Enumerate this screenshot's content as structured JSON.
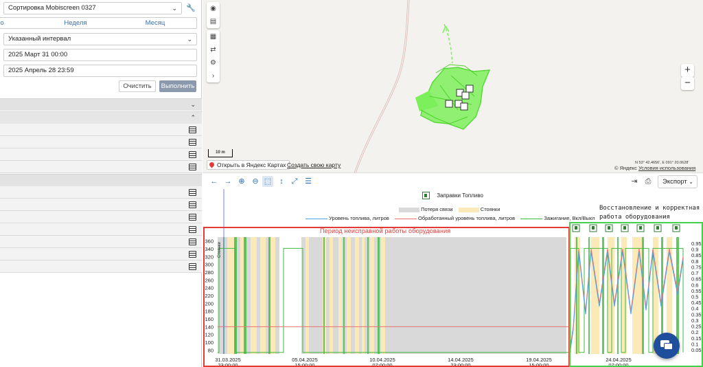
{
  "left_panel": {
    "sort_select": "Сортировка Mobiscreen 0327",
    "tabs": [
      "о",
      "Неделя",
      "Месяц"
    ],
    "interval_select": "Указанный интервал",
    "date_from": "2025 Март 31 00:00",
    "date_to": "2025 Апрель 28 23:59",
    "clear_label": "Очистить",
    "run_label": "Выполнить"
  },
  "map": {
    "open_label": "Открыть в Яндекс Картах",
    "create_label": "Создать свою карту",
    "scale_label": "10 m",
    "coords": "N 53° 42.4656', E 091° 20.0628'",
    "copyright": "© Яндекс",
    "terms": "Условия использования",
    "zoom_in": "+",
    "zoom_out": "−",
    "track_color": "#7cf05a"
  },
  "chart_toolbar": {
    "export_label": "Экспорт"
  },
  "chart": {
    "legend_fuel": "Заправки Топливо",
    "legend_no_signal": "Потеря связи",
    "legend_parking": "Стоянки",
    "legend_fuel_level": "Уровень топлива, литров",
    "legend_processed": "Обработанный уровень топлива, литров",
    "legend_ignition": "Зажигание, Вкл/Выкл",
    "note": "Восстановление и корректная работа оборудования",
    "red_title": "Период неисправной работы оборудования",
    "colors": {
      "no_signal": "#d9d9d9",
      "parking": "#fbe9b7",
      "fuel_level": "#4da3e0",
      "processed": "#e57373",
      "ignition": "#3fb93f",
      "red_frame": "#e53935",
      "green_frame": "#43d04a"
    }
  },
  "chart_data": {
    "type": "line",
    "y_left_ticks": [
      80,
      100,
      120,
      140,
      160,
      180,
      200,
      220,
      240,
      260,
      280,
      300,
      320,
      340,
      360
    ],
    "y_right_ticks": [
      0.05,
      0.1,
      0.15,
      0.2,
      0.25,
      0.3,
      0.35,
      0.4,
      0.45,
      0.5,
      0.55,
      0.6,
      0.65,
      0.7,
      0.75,
      0.8,
      0.85,
      0.9,
      0.95
    ],
    "x_ticks": [
      {
        "date": "31.03.2025",
        "time": "23:00:00"
      },
      {
        "date": "05.04.2025",
        "time": "15:00:00"
      },
      {
        "date": "10.04.2025",
        "time": "07:00:00"
      },
      {
        "date": "14.04.2025",
        "time": "23:00:00"
      },
      {
        "date": "19.04.2025",
        "time": "15:00:00"
      },
      {
        "date": "24.04.2025",
        "time": "07:00:00"
      }
    ],
    "y_left_range": [
      70,
      370
    ],
    "processed_level_flat": 140,
    "left_axis_label": "Стоянки"
  }
}
